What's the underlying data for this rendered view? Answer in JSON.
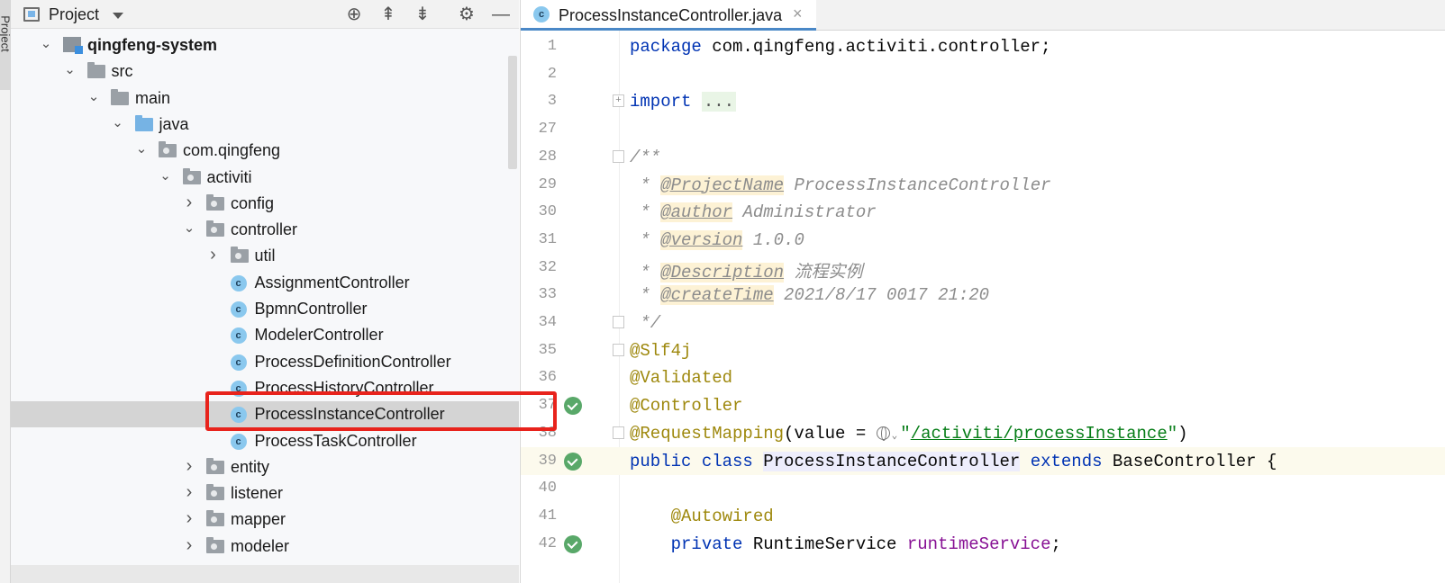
{
  "side_tool_window": {
    "label": "Project"
  },
  "project_panel": {
    "title": "Project",
    "header_icons": [
      "crosshair-icon",
      "collapse-all-icon",
      "expand-all-icon",
      "gear-icon",
      "minimize-icon"
    ],
    "tree": [
      {
        "label": "qingfeng-system",
        "level": 1,
        "expanded": true,
        "icon": "module",
        "bold": true
      },
      {
        "label": "src",
        "level": 2,
        "expanded": true,
        "icon": "folder"
      },
      {
        "label": "main",
        "level": 3,
        "expanded": true,
        "icon": "folder"
      },
      {
        "label": "java",
        "level": 4,
        "expanded": true,
        "icon": "source-folder"
      },
      {
        "label": "com.qingfeng",
        "level": 5,
        "expanded": true,
        "icon": "package"
      },
      {
        "label": "activiti",
        "level": 6,
        "expanded": true,
        "icon": "package"
      },
      {
        "label": "config",
        "level": 7,
        "expanded": false,
        "icon": "package"
      },
      {
        "label": "controller",
        "level": 7,
        "expanded": true,
        "icon": "package"
      },
      {
        "label": "util",
        "level": 8,
        "expanded": false,
        "icon": "package"
      },
      {
        "label": "AssignmentController",
        "level": 8,
        "icon": "class"
      },
      {
        "label": "BpmnController",
        "level": 8,
        "icon": "class"
      },
      {
        "label": "ModelerController",
        "level": 8,
        "icon": "class"
      },
      {
        "label": "ProcessDefinitionController",
        "level": 8,
        "icon": "class"
      },
      {
        "label": "ProcessHistoryController",
        "level": 8,
        "icon": "class"
      },
      {
        "label": "ProcessInstanceController",
        "level": 8,
        "icon": "class",
        "selected": true
      },
      {
        "label": "ProcessTaskController",
        "level": 8,
        "icon": "class"
      },
      {
        "label": "entity",
        "level": 7,
        "expanded": false,
        "icon": "package"
      },
      {
        "label": "listener",
        "level": 7,
        "expanded": false,
        "icon": "package"
      },
      {
        "label": "mapper",
        "level": 7,
        "expanded": false,
        "icon": "package"
      },
      {
        "label": "modeler",
        "level": 7,
        "expanded": false,
        "icon": "package"
      }
    ]
  },
  "editor": {
    "tab": {
      "label": "ProcessInstanceController.java",
      "icon": "class-icon",
      "close_glyph": "×"
    },
    "current_line": "39",
    "lines": [
      {
        "num": "1",
        "segments": [
          {
            "t": "package ",
            "c": "kw"
          },
          {
            "t": "com.qingfeng.activiti.controller;",
            "c": ""
          }
        ]
      },
      {
        "num": "2",
        "segments": []
      },
      {
        "num": "3",
        "fold": "+",
        "segments": [
          {
            "t": "import ",
            "c": "kw"
          },
          {
            "t": "...",
            "c": "fold-box"
          }
        ]
      },
      {
        "num": "27",
        "segments": []
      },
      {
        "num": "28",
        "fold": "-",
        "segments": [
          {
            "t": "/**",
            "c": "doc"
          }
        ]
      },
      {
        "num": "29",
        "segments": [
          {
            "t": " * ",
            "c": "doc"
          },
          {
            "t": "@ProjectName",
            "c": "doctag"
          },
          {
            "t": " ProcessInstanceController",
            "c": "doc"
          }
        ]
      },
      {
        "num": "30",
        "segments": [
          {
            "t": " * ",
            "c": "doc"
          },
          {
            "t": "@author",
            "c": "doctag"
          },
          {
            "t": " Administrator",
            "c": "doc"
          }
        ]
      },
      {
        "num": "31",
        "segments": [
          {
            "t": " * ",
            "c": "doc"
          },
          {
            "t": "@version",
            "c": "doctag"
          },
          {
            "t": " 1.0.0",
            "c": "doc"
          }
        ]
      },
      {
        "num": "32",
        "segments": [
          {
            "t": " * ",
            "c": "doc"
          },
          {
            "t": "@Description",
            "c": "doctag"
          },
          {
            "t": " 流程实例",
            "c": "doc"
          }
        ]
      },
      {
        "num": "33",
        "segments": [
          {
            "t": " * ",
            "c": "doc"
          },
          {
            "t": "@createTime",
            "c": "doctag"
          },
          {
            "t": " 2021/8/17 0017 21:20",
            "c": "doc"
          }
        ]
      },
      {
        "num": "34",
        "fold": "-",
        "segments": [
          {
            "t": " */",
            "c": "doc"
          }
        ]
      },
      {
        "num": "35",
        "fold": "-",
        "segments": [
          {
            "t": "@Slf4j",
            "c": "ann"
          }
        ]
      },
      {
        "num": "36",
        "segments": [
          {
            "t": "@Validated",
            "c": "ann"
          }
        ]
      },
      {
        "num": "37",
        "gutter": "bean-icon",
        "segments": [
          {
            "t": "@Controller",
            "c": "ann"
          }
        ]
      },
      {
        "num": "38",
        "fold": "-",
        "segments": [
          {
            "t": "@RequestMapping",
            "c": "ann"
          },
          {
            "t": "(value = ",
            "c": ""
          },
          {
            "t": "@globe",
            "c": ""
          },
          {
            "t": "\"",
            "c": "str"
          },
          {
            "t": "/activiti/processInstance",
            "c": "str str-u"
          },
          {
            "t": "\"",
            "c": "str"
          },
          {
            "t": ")",
            "c": ""
          }
        ]
      },
      {
        "num": "39",
        "gutter": "bean-icon",
        "segments": [
          {
            "t": "public ",
            "c": "kw"
          },
          {
            "t": "class ",
            "c": "kw"
          },
          {
            "t": "ProcessInstanceController",
            "c": "cls-hl"
          },
          {
            "t": " extends ",
            "c": "kw"
          },
          {
            "t": "BaseController {",
            "c": ""
          }
        ]
      },
      {
        "num": "40",
        "segments": []
      },
      {
        "num": "41",
        "segments": [
          {
            "t": "    ",
            "c": ""
          },
          {
            "t": "@Autowired",
            "c": "ann"
          }
        ]
      },
      {
        "num": "42",
        "gutter": "bean-icon",
        "segments": [
          {
            "t": "    ",
            "c": ""
          },
          {
            "t": "private ",
            "c": "kw"
          },
          {
            "t": "RuntimeService ",
            "c": ""
          },
          {
            "t": "runtimeService",
            "c": "field"
          },
          {
            "t": ";",
            "c": ""
          }
        ]
      }
    ]
  }
}
